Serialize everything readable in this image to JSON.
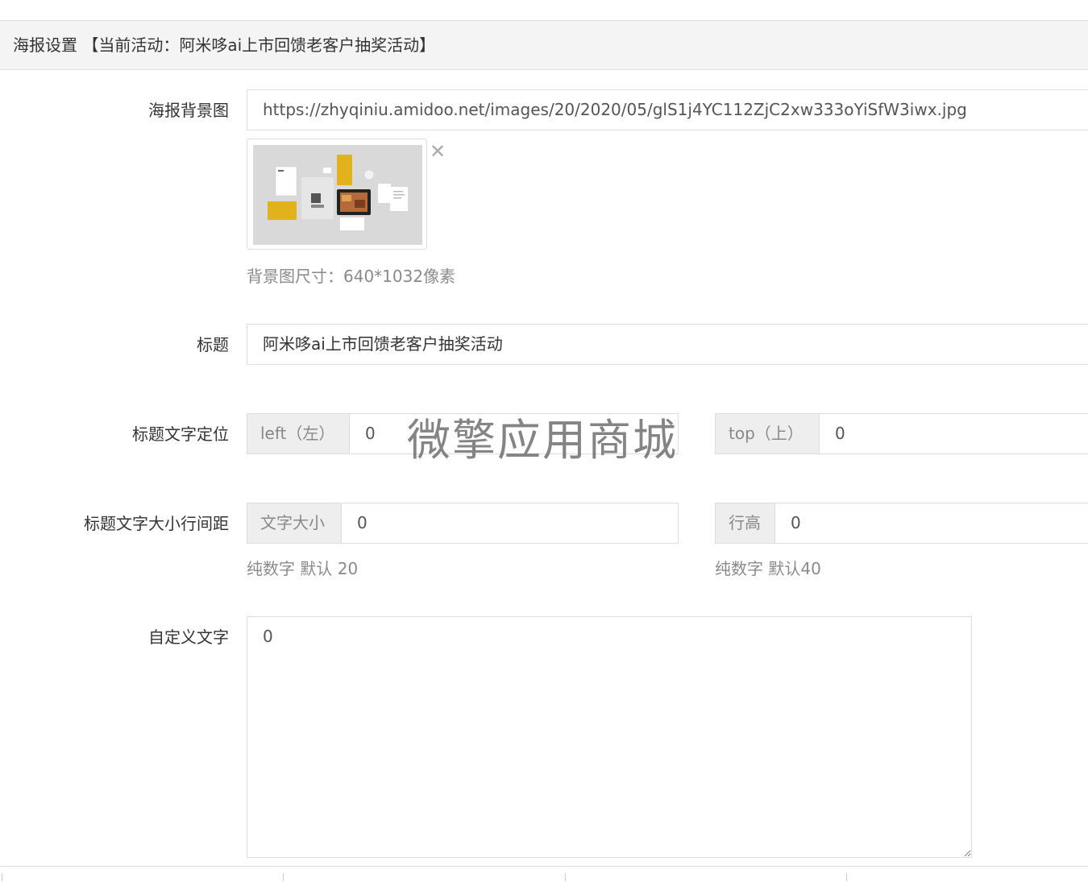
{
  "header": {
    "title": "海报设置 【当前活动：阿米哆ai上市回馈老客户抽奖活动】"
  },
  "form": {
    "background": {
      "label": "海报背景图",
      "value": "https://zhyqiniu.amidoo.net/images/20/2020/05/glS1j4YC112ZjC2xw333oYiSfW3iwx.jpg",
      "help": "背景图尺寸：640*1032像素",
      "remove_glyph": "✕"
    },
    "title": {
      "label": "标题",
      "value": "阿米哆ai上市回馈老客户抽奖活动"
    },
    "position": {
      "label": "标题文字定位",
      "left_addon": "left（左）",
      "left_value": "0",
      "top_addon": "top（上）",
      "top_value": "0"
    },
    "size": {
      "label": "标题文字大小行间距",
      "font_addon": "文字大小",
      "font_value": "0",
      "font_help": "纯数字 默认 20",
      "line_addon": "行高",
      "line_value": "0",
      "line_help": "纯数字 默认40"
    },
    "custom_text": {
      "label": "自定义文字",
      "value": "0"
    }
  },
  "watermark": "微擎应用商城",
  "colors": {
    "header_bg": "#f4f4f4",
    "addon_bg": "#eeeeee",
    "border": "#dddddd",
    "poster_yellow": "#e2b21c"
  }
}
